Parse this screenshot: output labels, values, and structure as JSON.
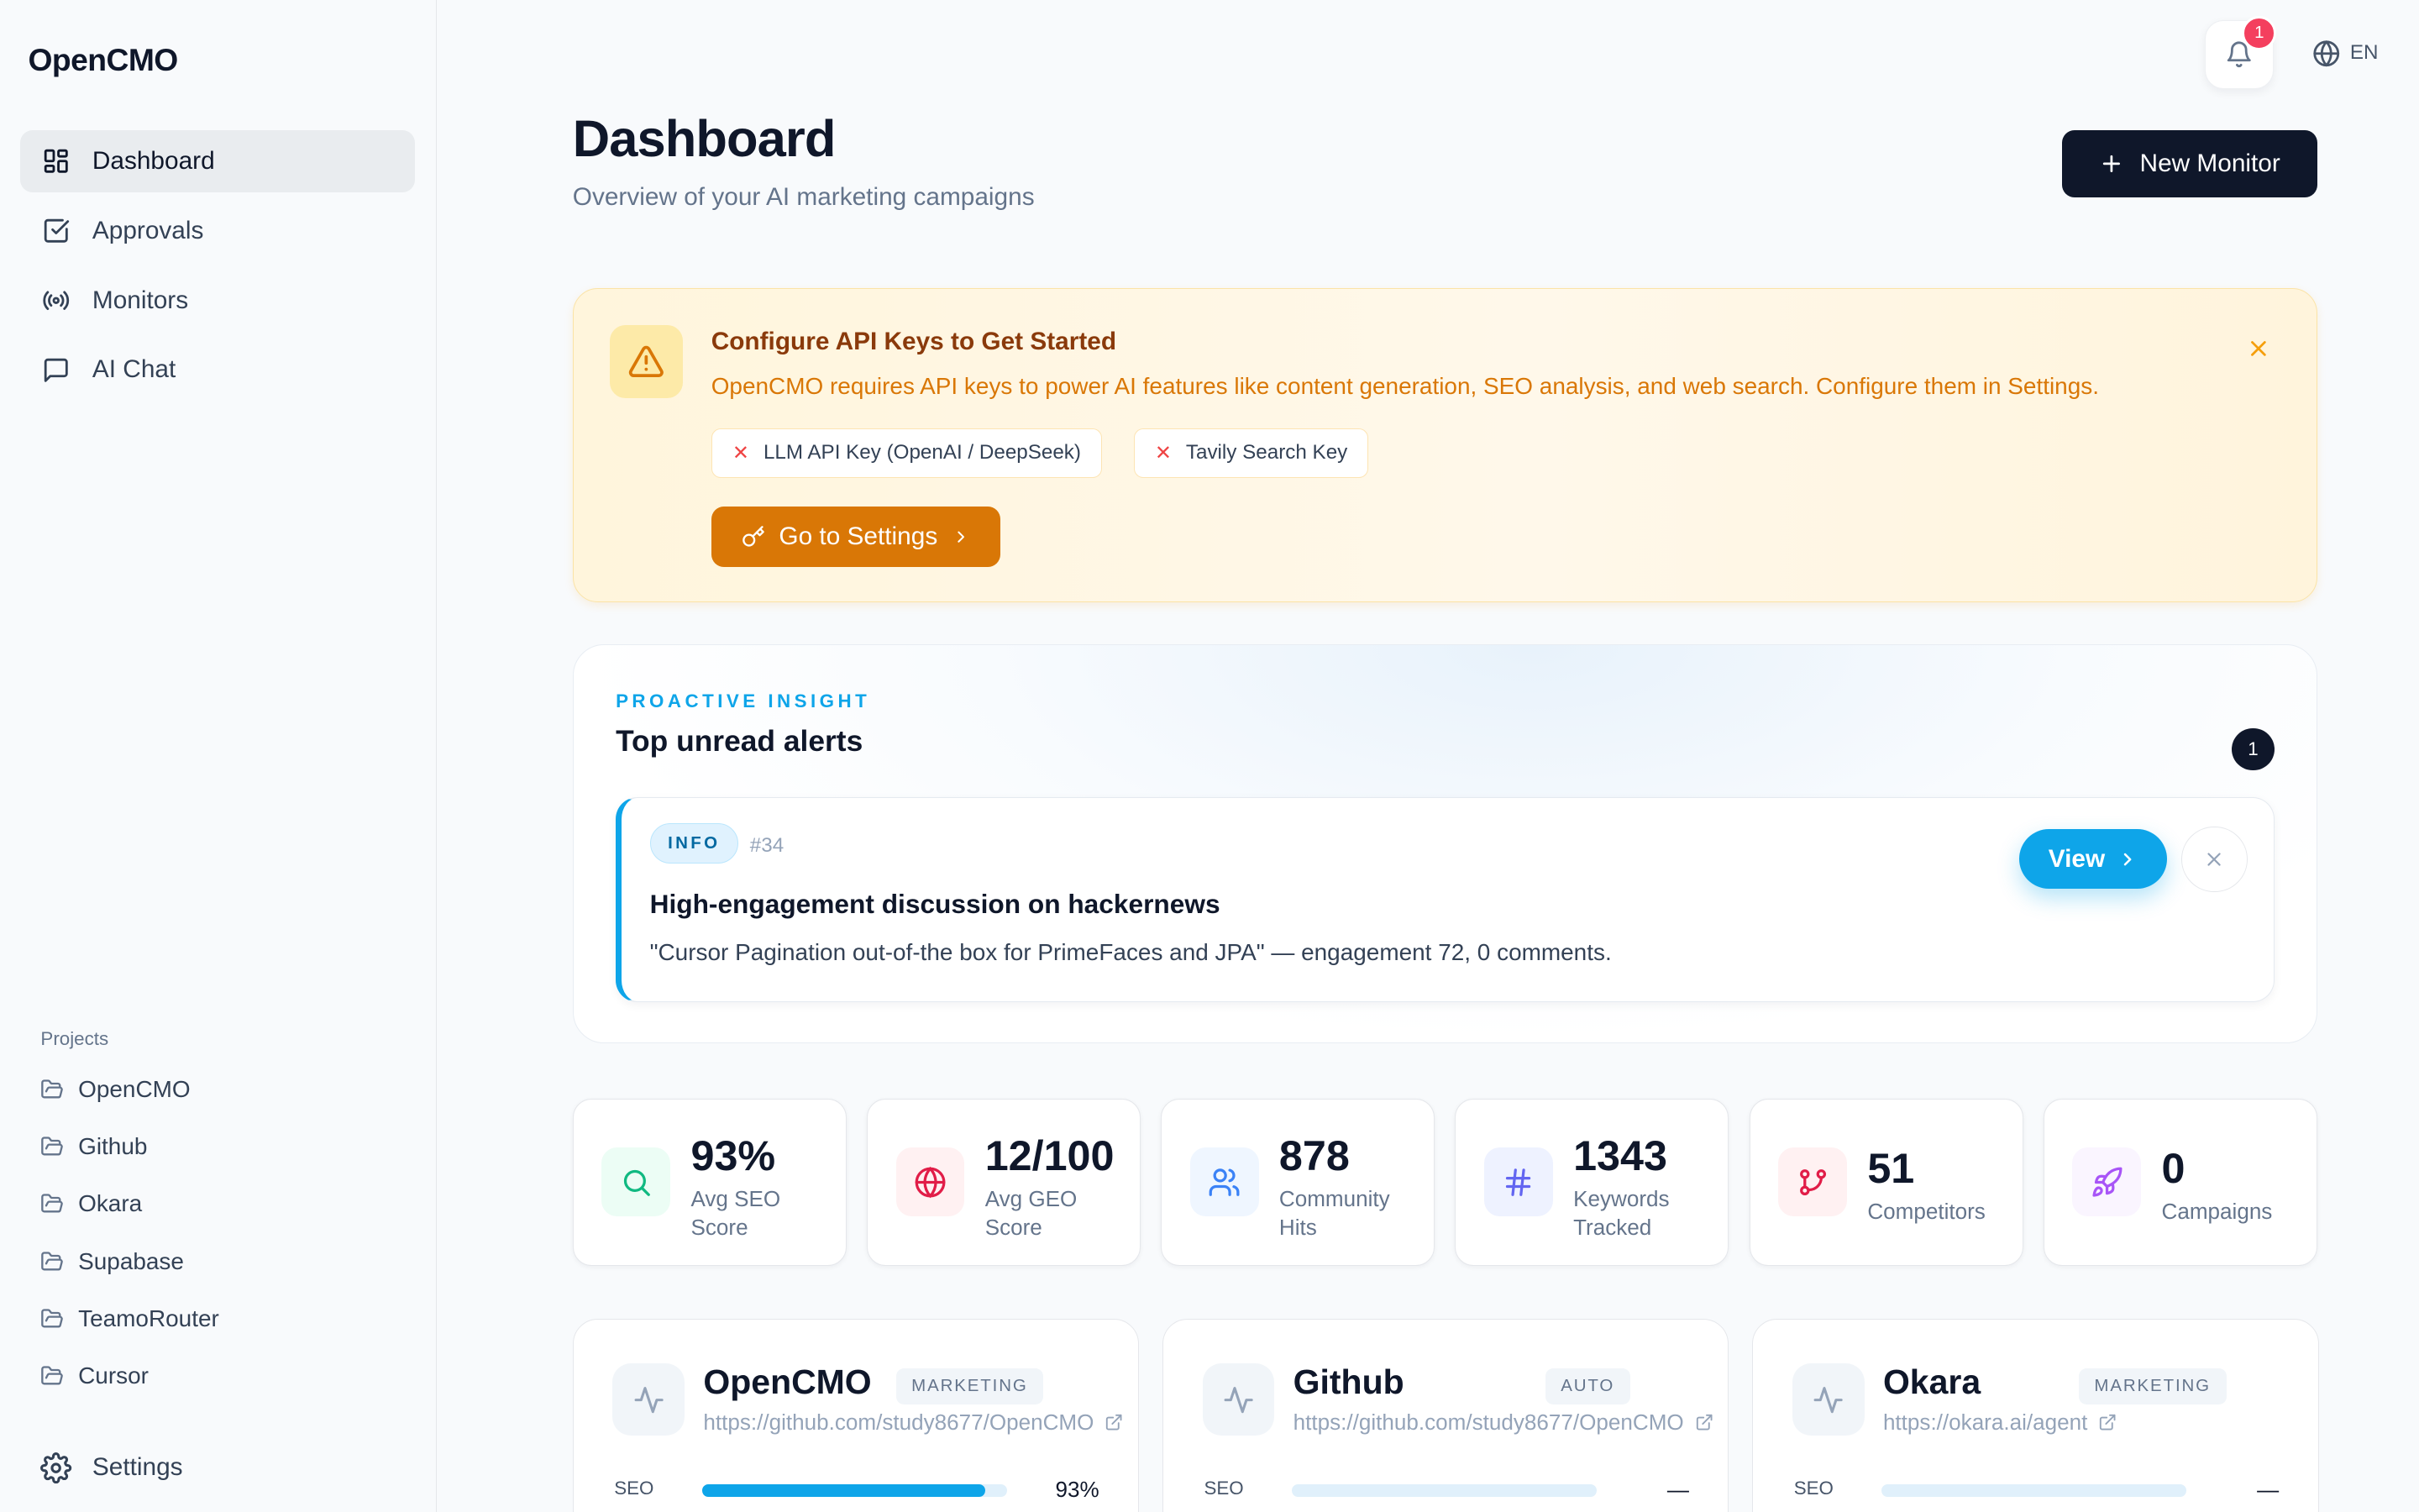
{
  "app": {
    "name": "OpenCMO"
  },
  "nav": {
    "items": [
      {
        "label": "Dashboard",
        "icon": "dashboard-icon",
        "active": true
      },
      {
        "label": "Approvals",
        "icon": "check-square-icon",
        "active": false
      },
      {
        "label": "Monitors",
        "icon": "radio-icon",
        "active": false
      },
      {
        "label": "AI Chat",
        "icon": "chat-icon",
        "active": false
      }
    ]
  },
  "projects": {
    "title": "Projects",
    "items": [
      {
        "label": "OpenCMO"
      },
      {
        "label": "Github"
      },
      {
        "label": "Okara"
      },
      {
        "label": "Supabase"
      },
      {
        "label": "TeamoRouter"
      },
      {
        "label": "Cursor"
      }
    ]
  },
  "settings": {
    "label": "Settings"
  },
  "topbar": {
    "notification_count": "1",
    "language": "EN"
  },
  "header": {
    "title": "Dashboard",
    "subtitle": "Overview of your AI marketing campaigns",
    "new_monitor_label": "New Monitor"
  },
  "warning": {
    "title": "Configure API Keys to Get Started",
    "description": "OpenCMO requires API keys to power AI features like content generation, SEO analysis, and web search. Configure them in Settings.",
    "missing_keys": [
      "LLM API Key (OpenAI / DeepSeek)",
      "Tavily Search Key"
    ],
    "button_label": "Go to Settings"
  },
  "insight": {
    "label": "PROACTIVE INSIGHT",
    "title": "Top unread alerts",
    "count": "1",
    "alert": {
      "badge": "INFO",
      "id": "#34",
      "title": "High-engagement discussion on hackernews",
      "description": "\"Cursor Pagination out-of-the box for PrimeFaces and JPA\" — engagement 72, 0 comments.",
      "view_label": "View"
    }
  },
  "stats": [
    {
      "value": "93%",
      "label": "Avg SEO Score",
      "icon": "search-icon",
      "color": "#10b981",
      "bg": "#ecfdf5"
    },
    {
      "value": "12/100",
      "label": "Avg GEO Score",
      "icon": "globe-icon",
      "color": "#e11d48",
      "bg": "#fff1f2"
    },
    {
      "value": "878",
      "label": "Community Hits",
      "icon": "users-icon",
      "color": "#3b82f6",
      "bg": "#eff6ff"
    },
    {
      "value": "1343",
      "label": "Keywords Tracked",
      "icon": "hash-icon",
      "color": "#6366f1",
      "bg": "#eef2ff"
    },
    {
      "value": "51",
      "label": "Competitors",
      "icon": "git-branch-icon",
      "color": "#e11d48",
      "bg": "#fff1f2"
    },
    {
      "value": "0",
      "label": "Campaigns",
      "icon": "rocket-icon",
      "color": "#a855f7",
      "bg": "#faf5ff"
    }
  ],
  "project_cards": [
    {
      "name": "OpenCMO",
      "tag": "MARKETING",
      "url": "https://github.com/study8677/OpenCMO",
      "seo_label": "SEO",
      "seo_value": "93%",
      "seo_fraction": 0.93
    },
    {
      "name": "Github",
      "tag": "AUTO",
      "url": "https://github.com/study8677/OpenCMO",
      "seo_label": "SEO",
      "seo_value": "—",
      "seo_fraction": 0
    },
    {
      "name": "Okara",
      "tag": "MARKETING",
      "url": "https://okara.ai/agent",
      "seo_label": "SEO",
      "seo_value": "—",
      "seo_fraction": 0
    }
  ],
  "colors": {
    "accent": "#0ea5e9",
    "primary": "#0f172a",
    "warning": "#d97706",
    "seo_bar": "#0ea5e9",
    "geo_bar": "#10b981"
  }
}
